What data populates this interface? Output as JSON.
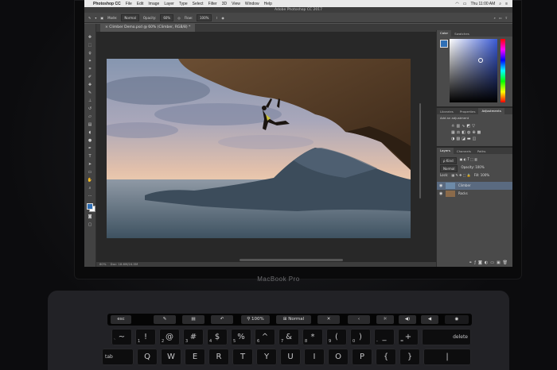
{
  "menubar": {
    "app_name": "Photoshop CC",
    "items": [
      "File",
      "Edit",
      "Image",
      "Layer",
      "Type",
      "Select",
      "Filter",
      "3D",
      "View",
      "Window",
      "Help"
    ],
    "clock": "Thu 11:00 AM"
  },
  "window_title": "Adobe Photoshop CC 2017",
  "options_bar": {
    "mode_label": "Mode:",
    "mode_value": "Normal",
    "opacity_label": "Opacity:",
    "opacity_value": "60%",
    "flow_label": "Flow:",
    "flow_value": "100%"
  },
  "document_tab": "Climber Demo.psd @ 60% (Climber, RGB/8) *",
  "status_bar": {
    "zoom": "60%",
    "doc": "Doc: 18.6M/24.5M"
  },
  "color_panel": {
    "tabs": [
      "Color",
      "Swatches"
    ],
    "foreground": "#2f6fb5"
  },
  "adjust_panel": {
    "tabs": [
      "Libraries",
      "Properties",
      "Adjustments"
    ],
    "add_label": "Add an adjustment"
  },
  "layers_panel": {
    "tabs": [
      "Layers",
      "Channels",
      "Paths"
    ],
    "kind_label": "ρ Kind",
    "blend": "Normal",
    "opacity_label": "Opacity: 100%",
    "fill_label": "Fill: 100%",
    "lock_label": "Lock:",
    "layers": [
      {
        "name": "Climber"
      },
      {
        "name": "Rocks"
      }
    ]
  },
  "laptop_brand": "MacBook Pro",
  "touchbar": {
    "esc": "esc",
    "zoom": "100%",
    "mode": "Normal"
  },
  "keyboard": {
    "row1": [
      "~",
      "!",
      "@",
      "#",
      "$",
      "%",
      "^",
      "&",
      "*",
      "(",
      ")",
      "_",
      "+"
    ],
    "row1_sub": [
      "`",
      "1",
      "2",
      "3",
      "4",
      "5",
      "6",
      "7",
      "8",
      "9",
      "0",
      "-",
      "="
    ],
    "delete": "delete",
    "tab": "tab",
    "row2": [
      "Q",
      "W",
      "E",
      "R",
      "T",
      "Y",
      "U",
      "I",
      "O",
      "P",
      "{",
      "}",
      "|"
    ]
  }
}
